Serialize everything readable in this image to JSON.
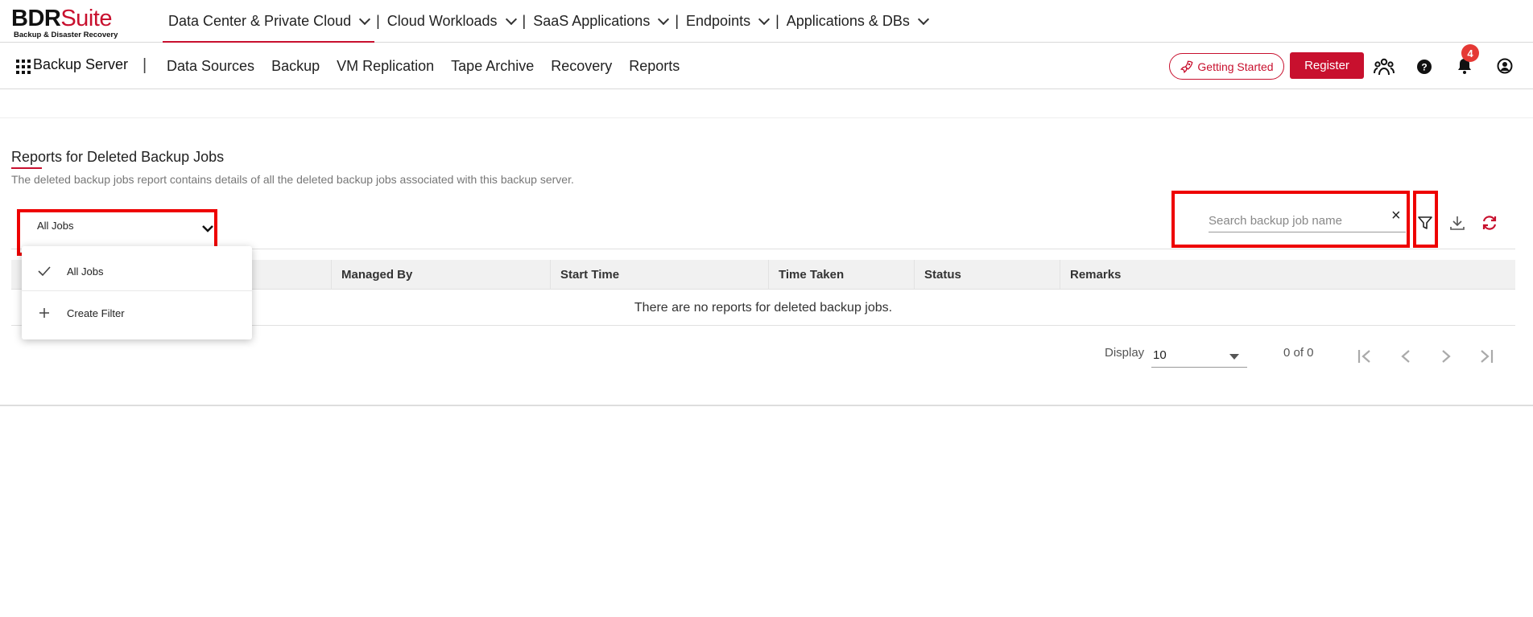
{
  "logo": {
    "brand_a": "BDR",
    "brand_b": "Suite",
    "tagline": "Backup & Disaster Recovery"
  },
  "product_nav": [
    {
      "label": "Data Center & Private Cloud",
      "active": true
    },
    {
      "label": "Cloud Workloads",
      "active": false
    },
    {
      "label": "SaaS Applications",
      "active": false
    },
    {
      "label": "Endpoints",
      "active": false
    },
    {
      "label": "Applications & DBs",
      "active": false
    }
  ],
  "separator": "|",
  "server": {
    "label": "Backup Server"
  },
  "main_nav": [
    "Data Sources",
    "Backup",
    "VM Replication",
    "Tape Archive",
    "Recovery",
    "Reports"
  ],
  "header_actions": {
    "getting_started": "Getting Started",
    "register": "Register",
    "notification_count": "4",
    "icons": [
      "community-icon",
      "help-icon",
      "bell-icon",
      "user-icon"
    ]
  },
  "page": {
    "title": "Reports for Deleted Backup Jobs",
    "description": "The deleted backup jobs report contains details of all the deleted backup jobs associated with this backup server."
  },
  "job_filter": {
    "selected": "All Jobs",
    "options": [
      {
        "label": "All Jobs",
        "checked": true
      },
      {
        "label": "Create Filter",
        "checked": false
      }
    ]
  },
  "search": {
    "placeholder": "Search backup job name",
    "clear": "×"
  },
  "table": {
    "columns": [
      "Managed By",
      "Start Time",
      "Time Taken",
      "Status",
      "Remarks"
    ],
    "empty_message": "There are no reports for deleted backup jobs."
  },
  "pagination": {
    "display_label": "Display",
    "page_size": "10",
    "range": "0 of 0"
  },
  "colors": {
    "accent": "#c8102e",
    "highlight": "#ee0000",
    "badge": "#e53935"
  }
}
